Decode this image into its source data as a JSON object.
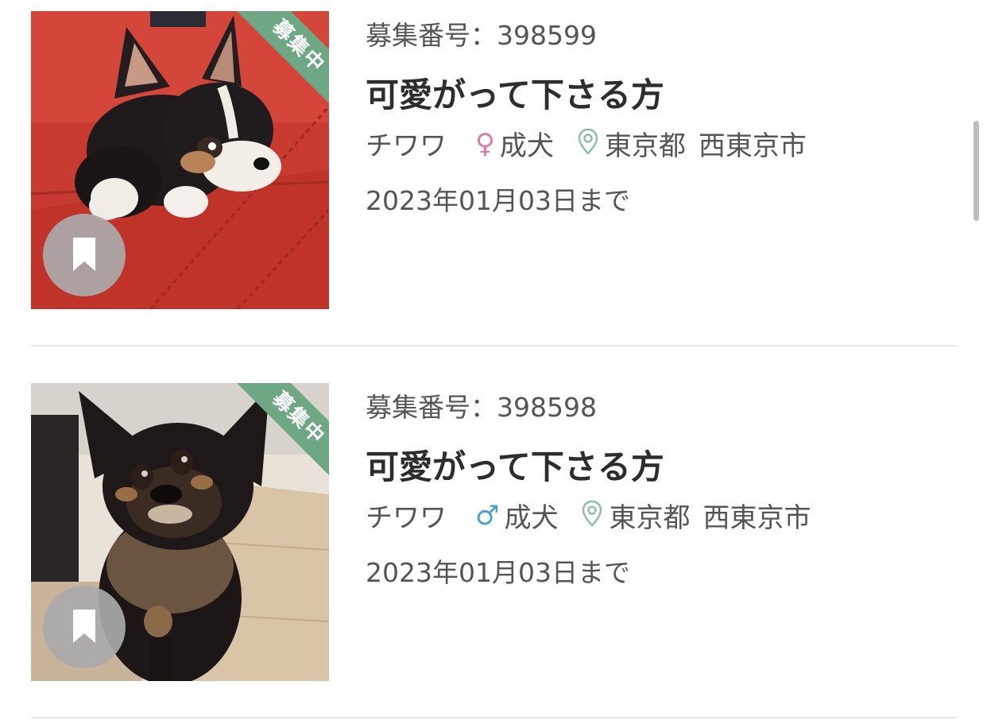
{
  "listings": [
    {
      "status_badge": "募集中",
      "post_id": "募集番号：398599",
      "title": "可愛がって下さる方",
      "breed": "チワワ",
      "gender_symbol": "♀",
      "gender_color": "#e07aa8",
      "age": "成犬",
      "prefecture": "東京都",
      "city": "西東京市",
      "deadline": "2023年01月03日まで",
      "photo_icon": "chihuahua-on-red-sofa-photo"
    },
    {
      "status_badge": "募集中",
      "post_id": "募集番号：398598",
      "title": "可愛がって下さる方",
      "breed": "チワワ",
      "gender_symbol": "♂",
      "gender_color": "#4a9fd8",
      "age": "成犬",
      "prefecture": "東京都",
      "city": "西東京市",
      "deadline": "2023年01月03日まで",
      "photo_icon": "long-haired-chihuahua-photo"
    }
  ],
  "colors": {
    "ribbon": "#6ea784",
    "pin_icon": "#8fbfa8",
    "bookmark_bg": "#aaaaaa"
  }
}
